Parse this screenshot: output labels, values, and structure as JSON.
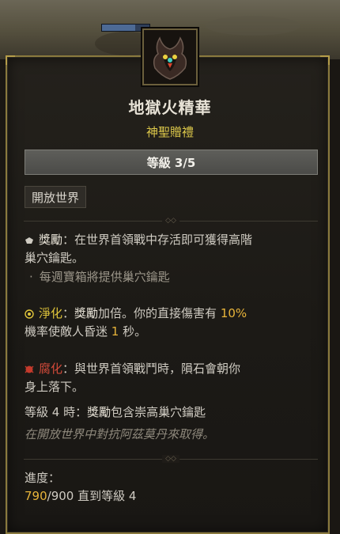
{
  "item": {
    "name": "地獄火精華",
    "type": "神聖贈禮",
    "rank": "等級 3/5",
    "tag": "開放世界"
  },
  "effects": {
    "reward_label": "獎勵",
    "reward_text_1": "：在世界首領戰中存活即可獲得高階",
    "reward_text_2": "巢穴鑰匙。",
    "reward_bullet": "每週寶箱將提供巢穴鑰匙",
    "purify_label": "淨化",
    "purify_sep": "：",
    "purify_word": "獎勵",
    "purify_text_a": "加倍。你的直接傷害有 ",
    "purify_pct": "10%",
    "purify_text_b": "機率使敵人昏迷 ",
    "purify_sec": "1",
    "purify_text_c": " 秒。",
    "corrupt_label": "腐化",
    "corrupt_text_1": "：與世界首領戰鬥時，隕石會朝你",
    "corrupt_text_2": "身上落下。",
    "rank4_prefix": "等級 4 時：",
    "rank4_word": "獎勵",
    "rank4_text": "包含崇高巢穴鑰匙",
    "source_hint": "在開放世界中對抗阿茲莫丹來取得。"
  },
  "progress": {
    "label": "進度：",
    "current": "790",
    "sep_total": "/900",
    "suffix": " 直到等級 4",
    "value": 790,
    "max": 900
  },
  "colors": {
    "border_gold": "#8a7a3e",
    "subtitle_yellow": "#ddc84a",
    "highlight_orange": "#e8b43a",
    "corruption_red": "#d24a3a",
    "purify_yellow": "#e0c53b"
  },
  "icons": {
    "item_icon": "hellfire-essence-icon",
    "reward_icon": "reward-chest-icon",
    "purify_icon": "purification-sun-icon",
    "corrupt_icon": "corruption-demon-icon"
  }
}
